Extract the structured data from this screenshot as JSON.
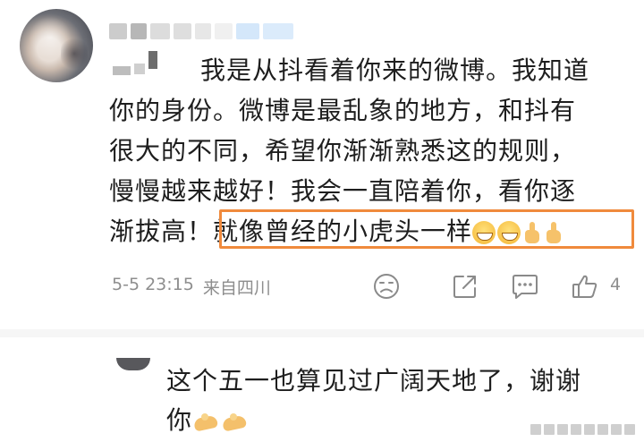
{
  "comment": {
    "line1": "我是从抖看着你来的微博。我知道",
    "line2": "你的身份。微博是最乱象的地方，和抖有",
    "line3": "很大的不同，希望你渐渐熟悉这的规则，",
    "line4": "慢慢越来越好！我会一直陪着你，看你逐",
    "line5_prefix": "渐拔高！",
    "line5_highlight": "就像曾经的小虎头一样",
    "timestamp": "5-5 23:15",
    "location": "来自四川",
    "like_count": "4",
    "emoji_icons": [
      "grinning-face-icon",
      "grinning-face-icon",
      "thumbs-up-icon",
      "thumbs-up-icon"
    ]
  },
  "reply": {
    "line1": "这个五一也算见过广阔天地了，谢谢",
    "line2": "你",
    "emoji_icons": [
      "praying-hands-icon",
      "praying-hands-icon"
    ]
  },
  "colors": {
    "highlight_border": "#f08a3c",
    "meta_text": "#8e8e8e",
    "icon_stroke": "#8a8a8a"
  }
}
